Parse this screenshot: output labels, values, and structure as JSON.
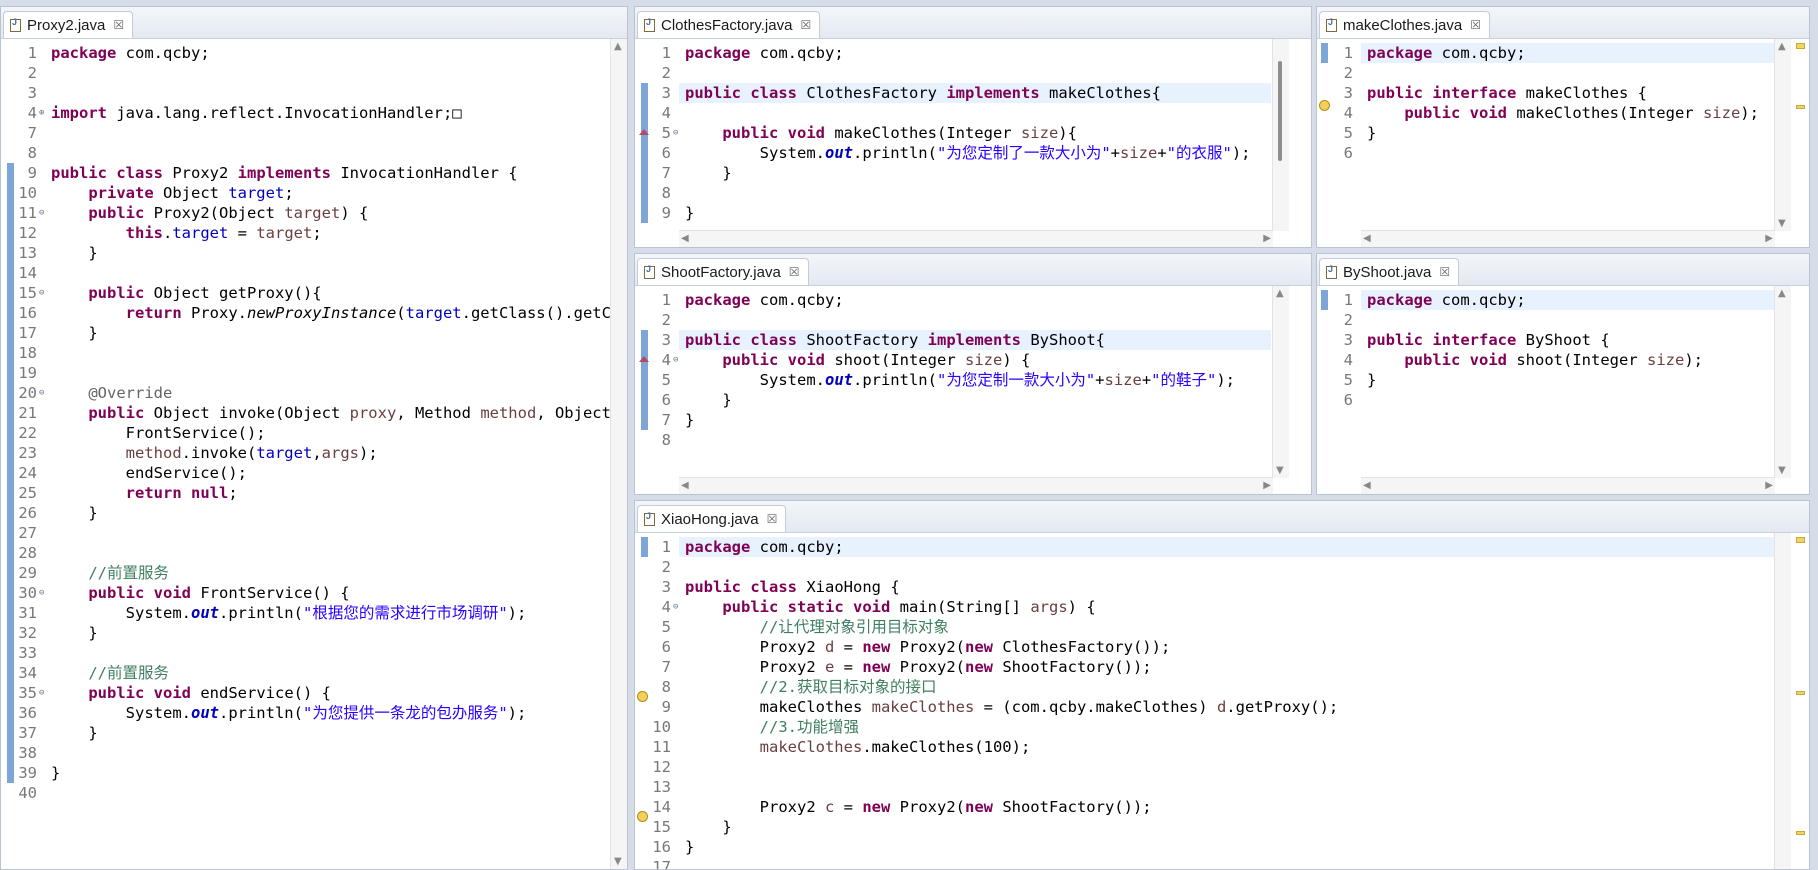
{
  "editors": {
    "proxy2": {
      "tab": "Proxy2.java",
      "lines": [
        {
          "n": "1",
          "h": "<span class='kw'>package</span> com.qcby;"
        },
        {
          "n": "2",
          "h": ""
        },
        {
          "n": "3",
          "h": ""
        },
        {
          "n": "4",
          "h": "<span class='kw'>import</span> java.lang.reflect.InvocationHandler;&#9633;"
        },
        {
          "n": "7",
          "h": ""
        },
        {
          "n": "8",
          "h": ""
        },
        {
          "n": "9",
          "h": "<span class='kw'>public</span> <span class='kw'>class</span> Proxy2 <span class='kw'>implements</span> InvocationHandler {"
        },
        {
          "n": "10",
          "h": "    <span class='kw'>private</span> Object <span class='fld'>target</span>;"
        },
        {
          "n": "11",
          "h": "    <span class='kw'>public</span> Proxy2(Object <span class='par'>target</span>) {"
        },
        {
          "n": "12",
          "h": "        <span class='kw'>this</span>.<span class='fld'>target</span> = <span class='par'>target</span>;"
        },
        {
          "n": "13",
          "h": "    }"
        },
        {
          "n": "14",
          "h": ""
        },
        {
          "n": "15",
          "h": "    <span class='kw'>public</span> Object getProxy(){"
        },
        {
          "n": "16",
          "h": "        <span class='kw'>return</span> Proxy.<span class='smeth'>newProxyInstance</span>(<span class='fld'>target</span>.getClass().getCl"
        },
        {
          "n": "17",
          "h": "    }"
        },
        {
          "n": "18",
          "h": ""
        },
        {
          "n": "19",
          "h": ""
        },
        {
          "n": "20",
          "h": "    <span class='ann'>@Override</span>"
        },
        {
          "n": "21",
          "h": "    <span class='kw'>public</span> Object invoke(Object <span class='par'>proxy</span>, Method <span class='par'>method</span>, Object["
        },
        {
          "n": "22",
          "h": "        FrontService();"
        },
        {
          "n": "23",
          "h": "        <span class='par'>method</span>.invoke(<span class='fld'>target</span>,<span class='par'>args</span>);"
        },
        {
          "n": "24",
          "h": "        endService();"
        },
        {
          "n": "25",
          "h": "        <span class='kw'>return</span> <span class='kw'>null</span>;"
        },
        {
          "n": "26",
          "h": "    }"
        },
        {
          "n": "27",
          "h": ""
        },
        {
          "n": "28",
          "h": ""
        },
        {
          "n": "29",
          "h": "    <span class='cmt'>//前置服务</span>"
        },
        {
          "n": "30",
          "h": "    <span class='kw'>public</span> <span class='kw'>void</span> FrontService() {"
        },
        {
          "n": "31",
          "h": "        System.<span class='sfld'>out</span>.println(<span class='str'>\"根据您的需求进行市场调研\"</span>);"
        },
        {
          "n": "32",
          "h": "    }"
        },
        {
          "n": "33",
          "h": ""
        },
        {
          "n": "34",
          "h": "    <span class='cmt'>//前置服务</span>"
        },
        {
          "n": "35",
          "h": "    <span class='kw'>public</span> <span class='kw'>void</span> endService() {"
        },
        {
          "n": "36",
          "h": "        System.<span class='sfld'>out</span>.println(<span class='str'>\"为您提供一条龙的包办服务\"</span>);"
        },
        {
          "n": "37",
          "h": "    }"
        },
        {
          "n": "38",
          "h": ""
        },
        {
          "n": "39",
          "h": "}"
        },
        {
          "n": "40",
          "h": ""
        }
      ]
    },
    "clothesFactory": {
      "tab": "ClothesFactory.java",
      "lines": [
        {
          "n": "1",
          "h": "<span class='kw'>package</span> com.qcby;"
        },
        {
          "n": "2",
          "h": ""
        },
        {
          "n": "3",
          "h": "<span class='kw'>public</span> <span class='kw'>class</span> ClothesFactory <span class='kw'>implements</span> makeClothes{"
        },
        {
          "n": "4",
          "h": ""
        },
        {
          "n": "5",
          "h": "    <span class='kw'>public</span> <span class='kw'>void</span> makeClothes(Integer <span class='par'>size</span>){"
        },
        {
          "n": "6",
          "h": "        System.<span class='sfld'>out</span>.println(<span class='str'>\"为您定制了一款大小为\"</span>+<span class='par'>size</span>+<span class='str'>\"的衣服\"</span>);"
        },
        {
          "n": "7",
          "h": "    }"
        },
        {
          "n": "8",
          "h": ""
        },
        {
          "n": "9",
          "h": "}"
        }
      ]
    },
    "makeClothes": {
      "tab": "makeClothes.java",
      "lines": [
        {
          "n": "1",
          "h": "<span class='kw'>package</span> com.qcby;"
        },
        {
          "n": "2",
          "h": ""
        },
        {
          "n": "3",
          "h": "<span class='kw'>public</span> <span class='kw'>interface</span> makeClothes {"
        },
        {
          "n": "4",
          "h": "    <span class='kw'>public</span> <span class='kw'>void</span> makeClothes(Integer <span class='par'>size</span>);"
        },
        {
          "n": "5",
          "h": "}"
        },
        {
          "n": "6",
          "h": ""
        }
      ]
    },
    "shootFactory": {
      "tab": "ShootFactory.java",
      "lines": [
        {
          "n": "1",
          "h": "<span class='kw'>package</span> com.qcby;"
        },
        {
          "n": "2",
          "h": ""
        },
        {
          "n": "3",
          "h": "<span class='kw'>public</span> <span class='kw'>class</span> ShootFactory <span class='kw'>implements</span> ByShoot{"
        },
        {
          "n": "4",
          "h": "    <span class='kw'>public</span> <span class='kw'>void</span> shoot(Integer <span class='par'>size</span>) {"
        },
        {
          "n": "5",
          "h": "        System.<span class='sfld'>out</span>.println(<span class='str'>\"为您定制一款大小为\"</span>+<span class='par'>size</span>+<span class='str'>\"的鞋子\"</span>);"
        },
        {
          "n": "6",
          "h": "    }"
        },
        {
          "n": "7",
          "h": "}"
        },
        {
          "n": "8",
          "h": ""
        }
      ]
    },
    "byShoot": {
      "tab": "ByShoot.java",
      "lines": [
        {
          "n": "1",
          "h": "<span class='kw'>package</span> com.qcby;"
        },
        {
          "n": "2",
          "h": ""
        },
        {
          "n": "3",
          "h": "<span class='kw'>public</span> <span class='kw'>interface</span> ByShoot {"
        },
        {
          "n": "4",
          "h": "    <span class='kw'>public</span> <span class='kw'>void</span> shoot(Integer <span class='par'>size</span>);"
        },
        {
          "n": "5",
          "h": "}"
        },
        {
          "n": "6",
          "h": ""
        }
      ]
    },
    "xiaoHong": {
      "tab": "XiaoHong.java",
      "lines": [
        {
          "n": "1",
          "h": "<span class='kw'>package</span> com.qcby;"
        },
        {
          "n": "2",
          "h": ""
        },
        {
          "n": "3",
          "h": "<span class='kw'>public</span> <span class='kw'>class</span> XiaoHong {"
        },
        {
          "n": "4",
          "h": "    <span class='kw'>public</span> <span class='kw'>static</span> <span class='kw'>void</span> main(String[] <span class='par'>args</span>) {"
        },
        {
          "n": "5",
          "h": "        <span class='cmt'>//让代理对象引用目标对象</span>"
        },
        {
          "n": "6",
          "h": "        Proxy2 <span class='par'>d</span> = <span class='kw'>new</span> Proxy2(<span class='kw'>new</span> ClothesFactory());"
        },
        {
          "n": "7",
          "h": "        Proxy2 <span class='par'>e</span> = <span class='kw'>new</span> Proxy2(<span class='kw'>new</span> ShootFactory());"
        },
        {
          "n": "8",
          "h": "        <span class='cmt'>//2.获取目标对象的接口</span>"
        },
        {
          "n": "9",
          "h": "        makeClothes <span class='par'>makeClothes</span> = (com.qcby.makeClothes) <span class='par'>d</span>.getProxy();"
        },
        {
          "n": "10",
          "h": "        <span class='cmt'>//3.功能增强</span>"
        },
        {
          "n": "11",
          "h": "        <span class='par'>makeClothes</span>.makeClothes(100);"
        },
        {
          "n": "12",
          "h": ""
        },
        {
          "n": "13",
          "h": ""
        },
        {
          "n": "14",
          "h": "        Proxy2 <span class='par'>c</span> = <span class='kw'>new</span> Proxy2(<span class='kw'>new</span> ShootFactory());"
        },
        {
          "n": "15",
          "h": "    }"
        },
        {
          "n": "16",
          "h": "}"
        },
        {
          "n": "17",
          "h": ""
        }
      ]
    }
  }
}
